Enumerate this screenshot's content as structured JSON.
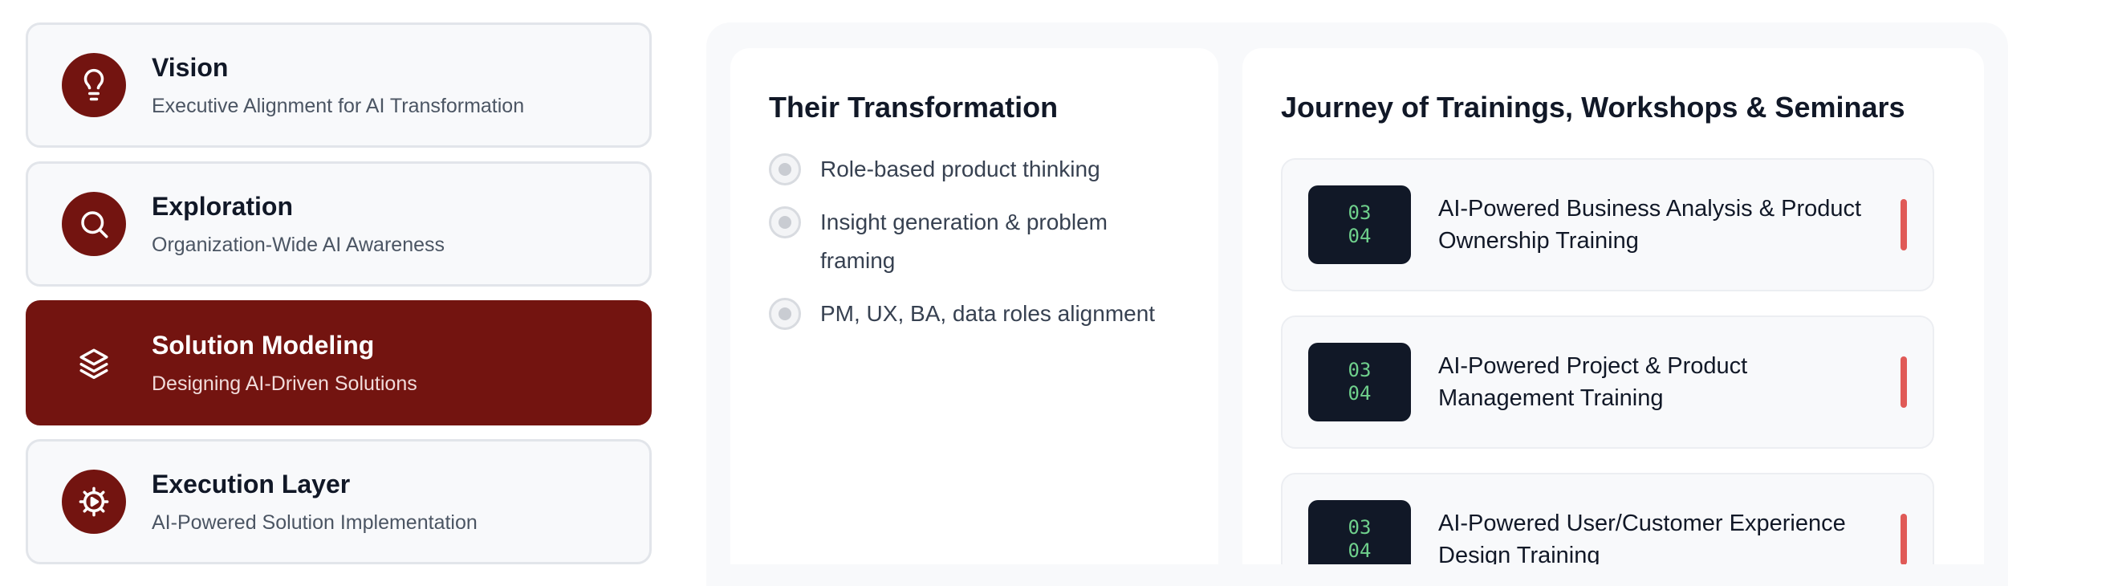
{
  "phases": [
    {
      "title": "Vision",
      "subtitle": "Executive Alignment for AI Transformation",
      "icon": "lightbulb-icon",
      "active": false
    },
    {
      "title": "Exploration",
      "subtitle": "Organization-Wide AI Awareness",
      "icon": "search-icon",
      "active": false
    },
    {
      "title": "Solution Modeling",
      "subtitle": "Designing AI-Driven Solutions",
      "icon": "layers-icon",
      "active": true
    },
    {
      "title": "Execution Layer",
      "subtitle": "AI-Powered Solution Implementation",
      "icon": "gear-play-icon",
      "active": false
    }
  ],
  "transformation": {
    "title": "Their Transformation",
    "items": [
      "Role-based product thinking",
      "Insight generation & problem framing",
      "PM, UX, BA, data roles alignment"
    ]
  },
  "journey": {
    "title": "Journey of Trainings, Workshops & Seminars",
    "items": [
      {
        "month": "03",
        "day": "04",
        "title": "AI-Powered Business Analysis & Product Ownership Training"
      },
      {
        "month": "03",
        "day": "04",
        "title": "AI-Powered Project & Product Management Training"
      },
      {
        "month": "03",
        "day": "04",
        "title": "AI-Powered User/Customer Experience Design Training"
      }
    ]
  },
  "colors": {
    "accent": "#731410",
    "badge_bg": "#111827",
    "badge_text": "#6fd08c",
    "indicator": "#e05a57"
  }
}
